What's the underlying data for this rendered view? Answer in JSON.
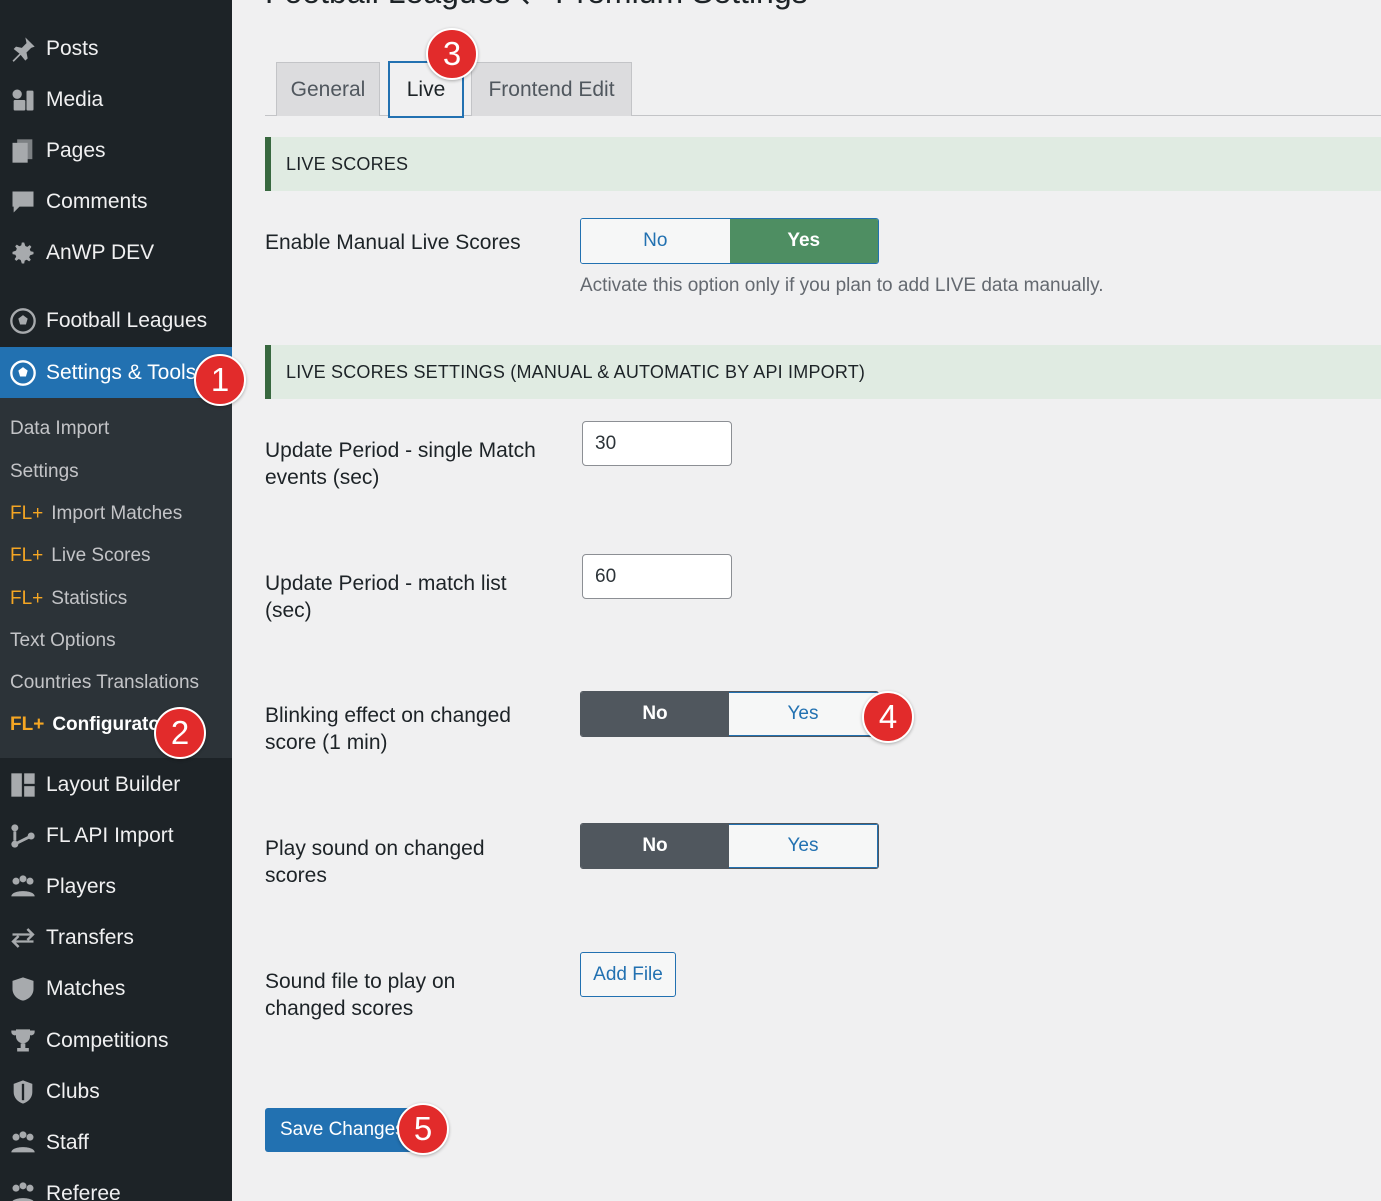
{
  "sidebar": {
    "items": [
      {
        "label": "Posts",
        "icon": "pin-icon"
      },
      {
        "label": "Media",
        "icon": "media-icon"
      },
      {
        "label": "Pages",
        "icon": "pages-icon"
      },
      {
        "label": "Comments",
        "icon": "comment-icon"
      },
      {
        "label": "AnWP DEV",
        "icon": "gear-icon"
      },
      {
        "label": "Football Leagues",
        "icon": "soccer-ball-icon"
      },
      {
        "label": "Settings & Tools",
        "icon": "soccer-ball-icon"
      },
      {
        "label": "Layout Builder",
        "icon": "layout-icon"
      },
      {
        "label": "FL API Import",
        "icon": "api-icon"
      },
      {
        "label": "Players",
        "icon": "players-icon"
      },
      {
        "label": "Transfers",
        "icon": "transfer-icon"
      },
      {
        "label": "Matches",
        "icon": "shield-icon"
      },
      {
        "label": "Competitions",
        "icon": "trophy-icon"
      },
      {
        "label": "Clubs",
        "icon": "club-shield-icon"
      },
      {
        "label": "Staff",
        "icon": "staff-icon"
      },
      {
        "label": "Referee",
        "icon": "referee-icon"
      }
    ],
    "submenu": [
      {
        "prefix": "",
        "label": "Data Import"
      },
      {
        "prefix": "",
        "label": "Settings"
      },
      {
        "prefix": "FL+",
        "label": "Import Matches"
      },
      {
        "prefix": "FL+",
        "label": "Live Scores"
      },
      {
        "prefix": "FL+",
        "label": "Statistics"
      },
      {
        "prefix": "",
        "label": "Text Options"
      },
      {
        "prefix": "",
        "label": "Countries Translations"
      },
      {
        "prefix": "FL+",
        "label": "Configurator"
      }
    ]
  },
  "page": {
    "title": "Football Leagues ⇄ Premium Settings",
    "tabs": [
      "General",
      "Live",
      "Frontend Edit"
    ],
    "active_tab": "Live"
  },
  "sections": {
    "live_scores": "LIVE SCORES",
    "live_settings": "LIVE SCORES SETTINGS (MANUAL & AUTOMATIC BY API IMPORT)"
  },
  "fields": {
    "enable_manual": {
      "label": "Enable Manual Live Scores",
      "no": "No",
      "yes": "Yes",
      "selected": "Yes",
      "description": "Activate this option only if you plan to add LIVE data manually."
    },
    "update_single": {
      "label": "Update Period - single Match events (sec)",
      "value": "30"
    },
    "update_list": {
      "label": "Update Period - match list (sec)",
      "value": "60"
    },
    "blinking": {
      "label": "Blinking effect on changed score (1 min)",
      "no": "No",
      "yes": "Yes",
      "selected": "No"
    },
    "play_sound": {
      "label": "Play sound on changed scores",
      "no": "No",
      "yes": "Yes",
      "selected": "No"
    },
    "sound_file": {
      "label": "Sound file to play on changed scores",
      "button": "Add File"
    }
  },
  "save_button": "Save Changes",
  "badges": [
    "1",
    "2",
    "3",
    "4",
    "5"
  ],
  "colors": {
    "accent": "#2271b1",
    "sidebar": "#1d2327",
    "toggle_on": "#4e8e62",
    "badge": "#e22b2b"
  }
}
